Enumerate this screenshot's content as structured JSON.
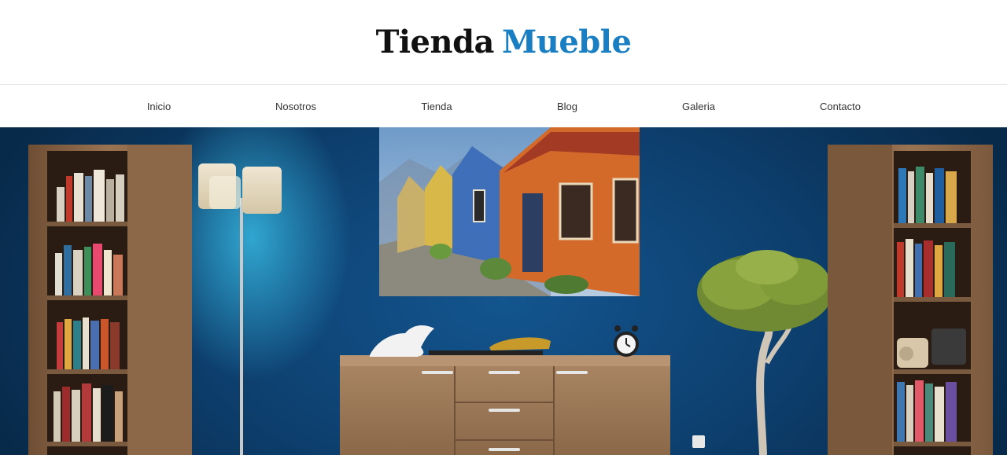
{
  "brand": {
    "part1": "Tienda",
    "part2": "Mueble",
    "accent_color": "#1a7fc2"
  },
  "nav": {
    "items": [
      {
        "label": "Inicio"
      },
      {
        "label": "Nosotros"
      },
      {
        "label": "Tienda"
      },
      {
        "label": "Blog"
      },
      {
        "label": "Galeria"
      },
      {
        "label": "Contacto"
      }
    ]
  },
  "hero": {
    "wall_color": "#0f4a80",
    "lamp_light_color": "#3cc8f0",
    "wood_color": "#8a6444"
  }
}
